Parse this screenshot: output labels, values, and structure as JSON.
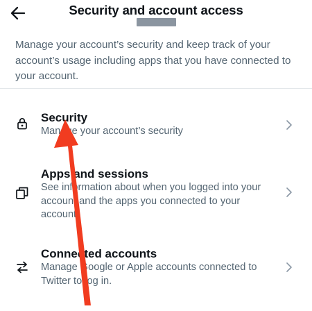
{
  "header": {
    "title": "Security and account access",
    "back_icon": "arrow-left-icon"
  },
  "description": "Manage your account’s security and keep track of your account’s usage including apps that you have connected to your account.",
  "items": [
    {
      "title": "Security",
      "desc": "Manage your account’s security",
      "icon": "lock-icon"
    },
    {
      "title": "Apps and sessions",
      "desc": "See information about when you logged into your account and the apps you connected to your account.",
      "icon": "copy-windows-icon"
    },
    {
      "title": "Connected accounts",
      "desc": "Manage Google or Apple accounts connected to Twitter to log in.",
      "icon": "swap-arrows-icon"
    }
  ],
  "colors": {
    "text": "#0f1419",
    "secondary_text": "#536471",
    "annotation_arrow": "#f13c20"
  }
}
